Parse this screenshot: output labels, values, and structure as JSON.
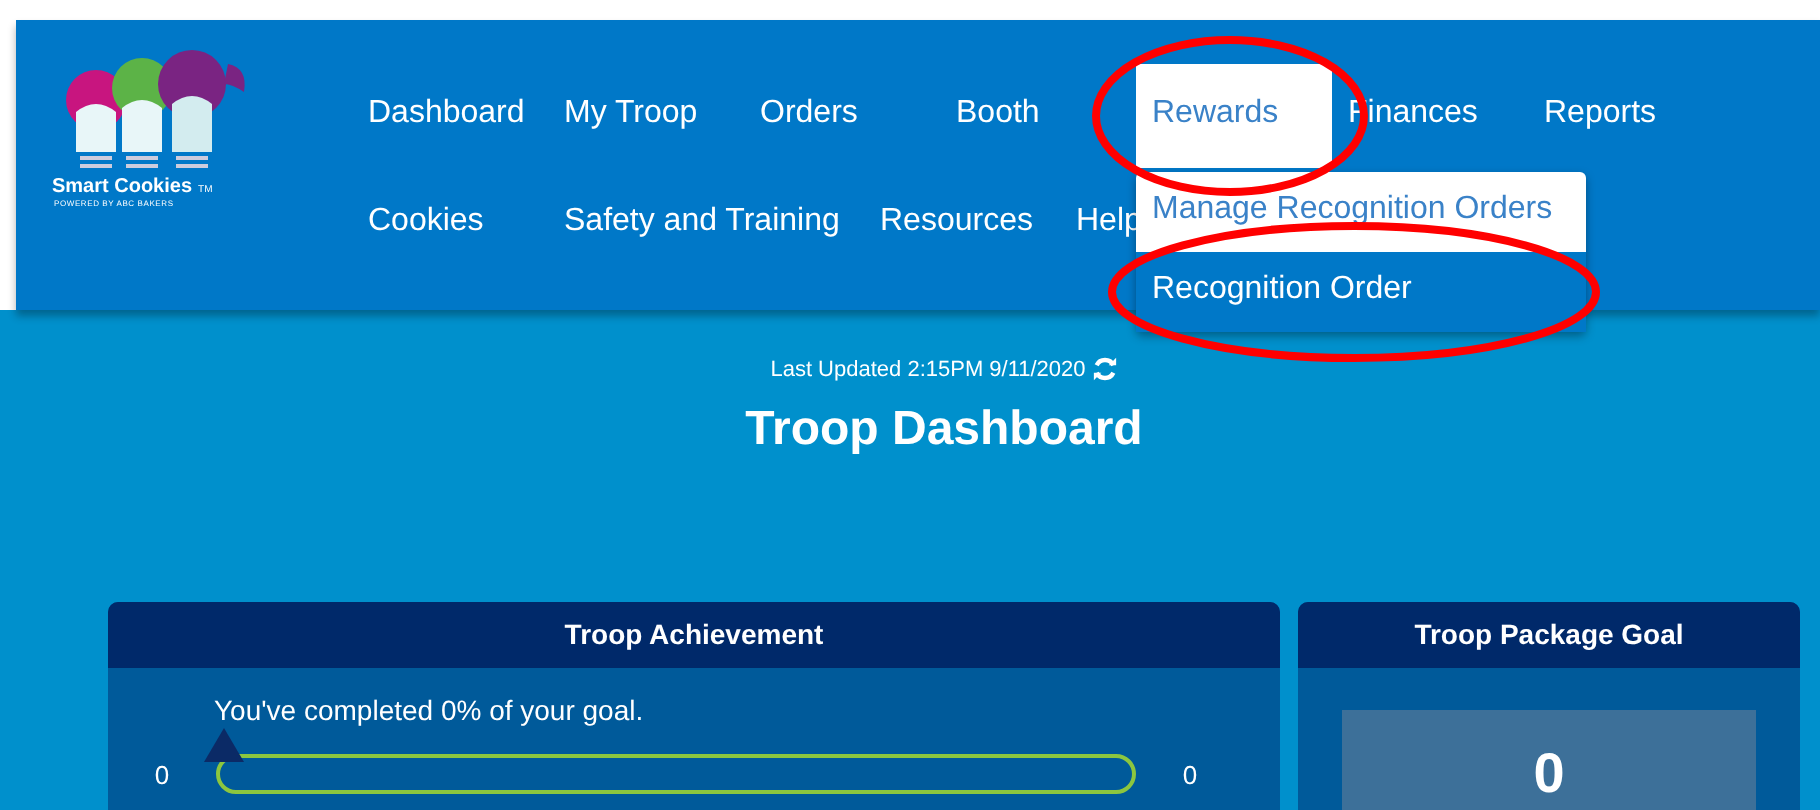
{
  "header": {
    "logo": {
      "name": "Smart Cookies",
      "tm": "TM",
      "tagline": "POWERED BY ABC BAKERS"
    },
    "nav_rows": [
      [
        {
          "label": "Dashboard",
          "selected": false
        },
        {
          "label": "My Troop",
          "selected": false
        },
        {
          "label": "Orders",
          "selected": false
        },
        {
          "label": "Booth",
          "selected": false
        },
        {
          "label": "Rewards",
          "selected": true
        },
        {
          "label": "Finances",
          "selected": false
        },
        {
          "label": "Reports",
          "selected": false
        }
      ],
      [
        {
          "label": "Cookies",
          "selected": false
        },
        {
          "label": "Safety and Training",
          "selected": false
        },
        {
          "label": "Resources",
          "selected": false
        },
        {
          "label": "Help",
          "selected": false
        }
      ]
    ],
    "dropdown": [
      {
        "label": "Manage Recognition Orders",
        "selected": false
      },
      {
        "label": "Recognition Order",
        "selected": true
      }
    ]
  },
  "last_updated": "Last Updated 2:15PM 9/11/2020",
  "title": "Troop Dashboard",
  "achievement": {
    "title": "Troop Achievement",
    "message": "You've completed 0% of your goal.",
    "min": "0",
    "max": "0",
    "level": 0
  },
  "package_goal": {
    "title": "Troop Package Goal",
    "value": "0"
  }
}
